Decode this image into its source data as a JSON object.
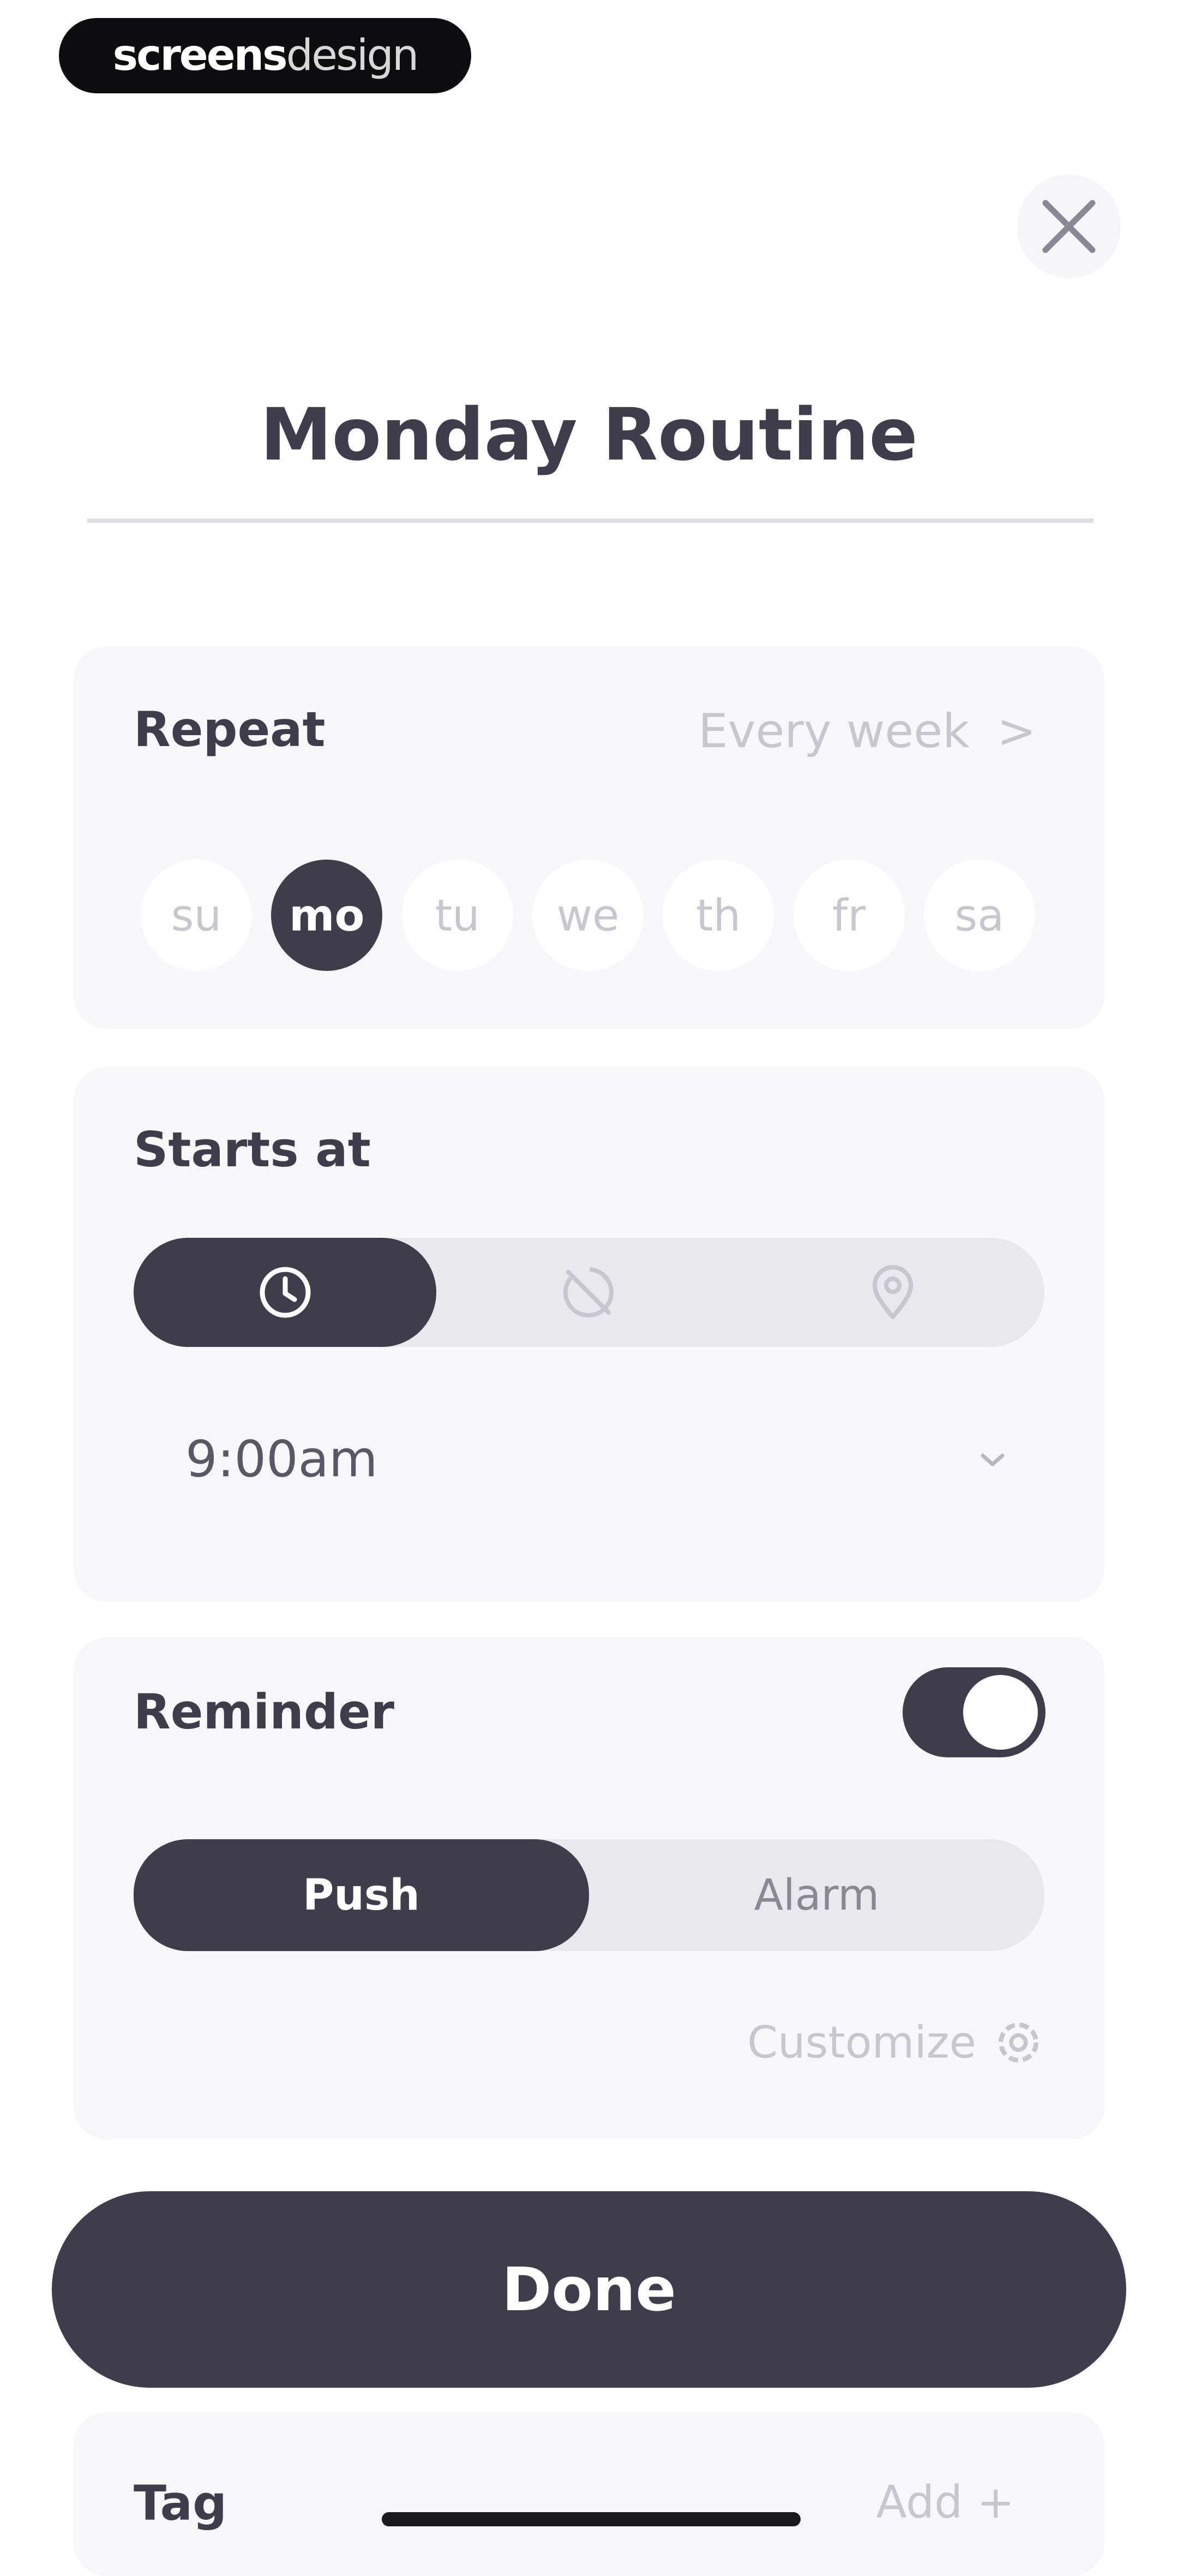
{
  "watermark": {
    "part1": "screens",
    "part2": "design"
  },
  "header": {
    "close_icon": "close-icon"
  },
  "title": "Monday Routine",
  "repeat": {
    "label": "Repeat",
    "value": "Every week",
    "chevron": ">",
    "days": [
      {
        "label": "su",
        "active": false
      },
      {
        "label": "mo",
        "active": true
      },
      {
        "label": "tu",
        "active": false
      },
      {
        "label": "we",
        "active": false
      },
      {
        "label": "th",
        "active": false
      },
      {
        "label": "fr",
        "active": false
      },
      {
        "label": "sa",
        "active": false
      }
    ]
  },
  "starts_at": {
    "label": "Starts at",
    "modes": [
      "clock-icon",
      "no-time-icon",
      "location-pin-icon"
    ],
    "selected_mode": "clock-icon",
    "time_value": "9:00am"
  },
  "reminder": {
    "label": "Reminder",
    "enabled": true,
    "options": [
      "Push",
      "Alarm"
    ],
    "selected": "Push",
    "customize_label": "Customize"
  },
  "done_label": "Done",
  "tag": {
    "label": "Tag",
    "add_label": "Add +"
  },
  "colors": {
    "primary": "#3f3d4c",
    "card": "#f8f7fa",
    "muted": "#c8c7cf",
    "track": "#e9e8ec"
  }
}
